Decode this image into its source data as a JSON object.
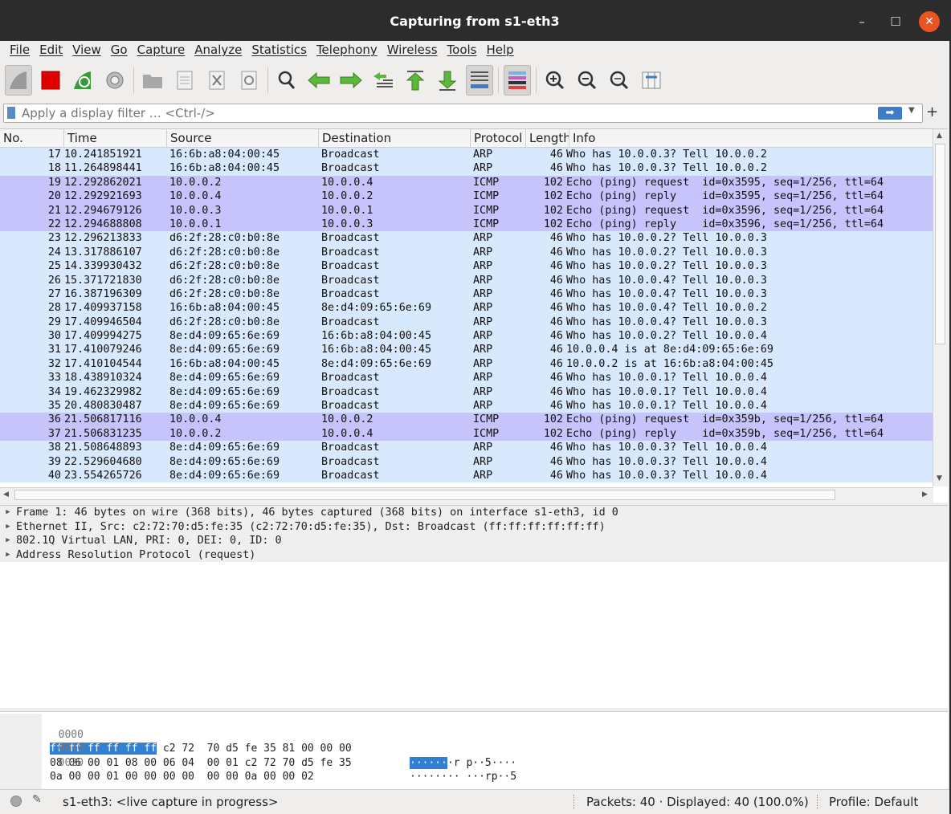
{
  "window": {
    "title": "Capturing from s1-eth3",
    "min_icon": "minimize-icon",
    "max_icon": "maximize-icon",
    "close_icon": "close-icon"
  },
  "menu": [
    "File",
    "Edit",
    "View",
    "Go",
    "Capture",
    "Analyze",
    "Statistics",
    "Telephony",
    "Wireless",
    "Tools",
    "Help"
  ],
  "toolbar": {
    "icons": [
      "shark-fin-start-icon",
      "stop-capture-icon",
      "restart-capture-icon",
      "capture-options-icon",
      "open-file-icon",
      "save-file-icon",
      "close-file-icon",
      "reload-file-icon",
      "find-packet-icon",
      "go-back-icon",
      "go-forward-icon",
      "go-to-packet-icon",
      "go-first-icon",
      "go-last-icon",
      "autoscroll-icon",
      "colorize-icon",
      "zoom-in-icon",
      "zoom-out-icon",
      "zoom-normal-icon",
      "resize-columns-icon"
    ]
  },
  "filter": {
    "placeholder": "Apply a display filter … <Ctrl-/>",
    "plus": "+"
  },
  "packet_list": {
    "columns": [
      "No.",
      "Time",
      "Source",
      "Destination",
      "Protocol",
      "Length",
      "Info"
    ],
    "rows": [
      {
        "no": "17",
        "time": "10.241851921",
        "src": "16:6b:a8:04:00:45",
        "dst": "Broadcast",
        "proto": "ARP",
        "len": "46",
        "info": "Who has 10.0.0.3? Tell 10.0.0.2"
      },
      {
        "no": "18",
        "time": "11.264898441",
        "src": "16:6b:a8:04:00:45",
        "dst": "Broadcast",
        "proto": "ARP",
        "len": "46",
        "info": "Who has 10.0.0.3? Tell 10.0.0.2"
      },
      {
        "no": "19",
        "time": "12.292862021",
        "src": "10.0.0.2",
        "dst": "10.0.0.4",
        "proto": "ICMP",
        "len": "102",
        "info": "Echo (ping) request  id=0x3595, seq=1/256, ttl=64"
      },
      {
        "no": "20",
        "time": "12.292921693",
        "src": "10.0.0.4",
        "dst": "10.0.0.2",
        "proto": "ICMP",
        "len": "102",
        "info": "Echo (ping) reply    id=0x3595, seq=1/256, ttl=64"
      },
      {
        "no": "21",
        "time": "12.294679126",
        "src": "10.0.0.3",
        "dst": "10.0.0.1",
        "proto": "ICMP",
        "len": "102",
        "info": "Echo (ping) request  id=0x3596, seq=1/256, ttl=64"
      },
      {
        "no": "22",
        "time": "12.294688808",
        "src": "10.0.0.1",
        "dst": "10.0.0.3",
        "proto": "ICMP",
        "len": "102",
        "info": "Echo (ping) reply    id=0x3596, seq=1/256, ttl=64"
      },
      {
        "no": "23",
        "time": "12.296213833",
        "src": "d6:2f:28:c0:b0:8e",
        "dst": "Broadcast",
        "proto": "ARP",
        "len": "46",
        "info": "Who has 10.0.0.2? Tell 10.0.0.3"
      },
      {
        "no": "24",
        "time": "13.317886107",
        "src": "d6:2f:28:c0:b0:8e",
        "dst": "Broadcast",
        "proto": "ARP",
        "len": "46",
        "info": "Who has 10.0.0.2? Tell 10.0.0.3"
      },
      {
        "no": "25",
        "time": "14.339930432",
        "src": "d6:2f:28:c0:b0:8e",
        "dst": "Broadcast",
        "proto": "ARP",
        "len": "46",
        "info": "Who has 10.0.0.2? Tell 10.0.0.3"
      },
      {
        "no": "26",
        "time": "15.371721830",
        "src": "d6:2f:28:c0:b0:8e",
        "dst": "Broadcast",
        "proto": "ARP",
        "len": "46",
        "info": "Who has 10.0.0.4? Tell 10.0.0.3"
      },
      {
        "no": "27",
        "time": "16.387196309",
        "src": "d6:2f:28:c0:b0:8e",
        "dst": "Broadcast",
        "proto": "ARP",
        "len": "46",
        "info": "Who has 10.0.0.4? Tell 10.0.0.3"
      },
      {
        "no": "28",
        "time": "17.409937158",
        "src": "16:6b:a8:04:00:45",
        "dst": "8e:d4:09:65:6e:69",
        "proto": "ARP",
        "len": "46",
        "info": "Who has 10.0.0.4? Tell 10.0.0.2"
      },
      {
        "no": "29",
        "time": "17.409946504",
        "src": "d6:2f:28:c0:b0:8e",
        "dst": "Broadcast",
        "proto": "ARP",
        "len": "46",
        "info": "Who has 10.0.0.4? Tell 10.0.0.3"
      },
      {
        "no": "30",
        "time": "17.409994275",
        "src": "8e:d4:09:65:6e:69",
        "dst": "16:6b:a8:04:00:45",
        "proto": "ARP",
        "len": "46",
        "info": "Who has 10.0.0.2? Tell 10.0.0.4"
      },
      {
        "no": "31",
        "time": "17.410079246",
        "src": "8e:d4:09:65:6e:69",
        "dst": "16:6b:a8:04:00:45",
        "proto": "ARP",
        "len": "46",
        "info": "10.0.0.4 is at 8e:d4:09:65:6e:69"
      },
      {
        "no": "32",
        "time": "17.410104544",
        "src": "16:6b:a8:04:00:45",
        "dst": "8e:d4:09:65:6e:69",
        "proto": "ARP",
        "len": "46",
        "info": "10.0.0.2 is at 16:6b:a8:04:00:45"
      },
      {
        "no": "33",
        "time": "18.438910324",
        "src": "8e:d4:09:65:6e:69",
        "dst": "Broadcast",
        "proto": "ARP",
        "len": "46",
        "info": "Who has 10.0.0.1? Tell 10.0.0.4"
      },
      {
        "no": "34",
        "time": "19.462329982",
        "src": "8e:d4:09:65:6e:69",
        "dst": "Broadcast",
        "proto": "ARP",
        "len": "46",
        "info": "Who has 10.0.0.1? Tell 10.0.0.4"
      },
      {
        "no": "35",
        "time": "20.480830487",
        "src": "8e:d4:09:65:6e:69",
        "dst": "Broadcast",
        "proto": "ARP",
        "len": "46",
        "info": "Who has 10.0.0.1? Tell 10.0.0.4"
      },
      {
        "no": "36",
        "time": "21.506817116",
        "src": "10.0.0.4",
        "dst": "10.0.0.2",
        "proto": "ICMP",
        "len": "102",
        "info": "Echo (ping) request  id=0x359b, seq=1/256, ttl=64"
      },
      {
        "no": "37",
        "time": "21.506831235",
        "src": "10.0.0.2",
        "dst": "10.0.0.4",
        "proto": "ICMP",
        "len": "102",
        "info": "Echo (ping) reply    id=0x359b, seq=1/256, ttl=64"
      },
      {
        "no": "38",
        "time": "21.508648893",
        "src": "8e:d4:09:65:6e:69",
        "dst": "Broadcast",
        "proto": "ARP",
        "len": "46",
        "info": "Who has 10.0.0.3? Tell 10.0.0.4"
      },
      {
        "no": "39",
        "time": "22.529604680",
        "src": "8e:d4:09:65:6e:69",
        "dst": "Broadcast",
        "proto": "ARP",
        "len": "46",
        "info": "Who has 10.0.0.3? Tell 10.0.0.4"
      },
      {
        "no": "40",
        "time": "23.554265726",
        "src": "8e:d4:09:65:6e:69",
        "dst": "Broadcast",
        "proto": "ARP",
        "len": "46",
        "info": "Who has 10.0.0.3? Tell 10.0.0.4"
      }
    ]
  },
  "details": [
    "Frame 1: 46 bytes on wire (368 bits), 46 bytes captured (368 bits) on interface s1-eth3, id 0",
    "Ethernet II, Src: c2:72:70:d5:fe:35 (c2:72:70:d5:fe:35), Dst: Broadcast (ff:ff:ff:ff:ff:ff)",
    "802.1Q Virtual LAN, PRI: 0, DEI: 0, ID: 0",
    "Address Resolution Protocol (request)"
  ],
  "bytes": [
    {
      "offset": "0000",
      "hex_hl": "ff ff ff ff ff ff",
      "hex_rest": " c2 72  70 d5 fe 35 81 00 00 00",
      "asc_hl": "······",
      "asc_rest": "·r p··5····"
    },
    {
      "offset": "0010",
      "hex_hl": "",
      "hex_rest": "08 06 00 01 08 00 06 04  00 01 c2 72 70 d5 fe 35",
      "asc_hl": "",
      "asc_rest": "········ ···rp··5"
    },
    {
      "offset": "0020",
      "hex_hl": "",
      "hex_rest": "0a 00 00 01 00 00 00 00  00 00 0a 00 00 02",
      "asc_hl": "",
      "asc_rest": "········ ······"
    }
  ],
  "status": {
    "message": "s1-eth3: <live capture in progress>",
    "packets": "Packets: 40 · Displayed: 40 (100.0%)",
    "profile": "Profile: Default"
  },
  "colors": {
    "arp_row": "#d8e8fd",
    "icmp_row": "#c7c3fb",
    "selection": "#3081d3",
    "titlebar": "#2c2c2c",
    "close": "#e95420"
  }
}
